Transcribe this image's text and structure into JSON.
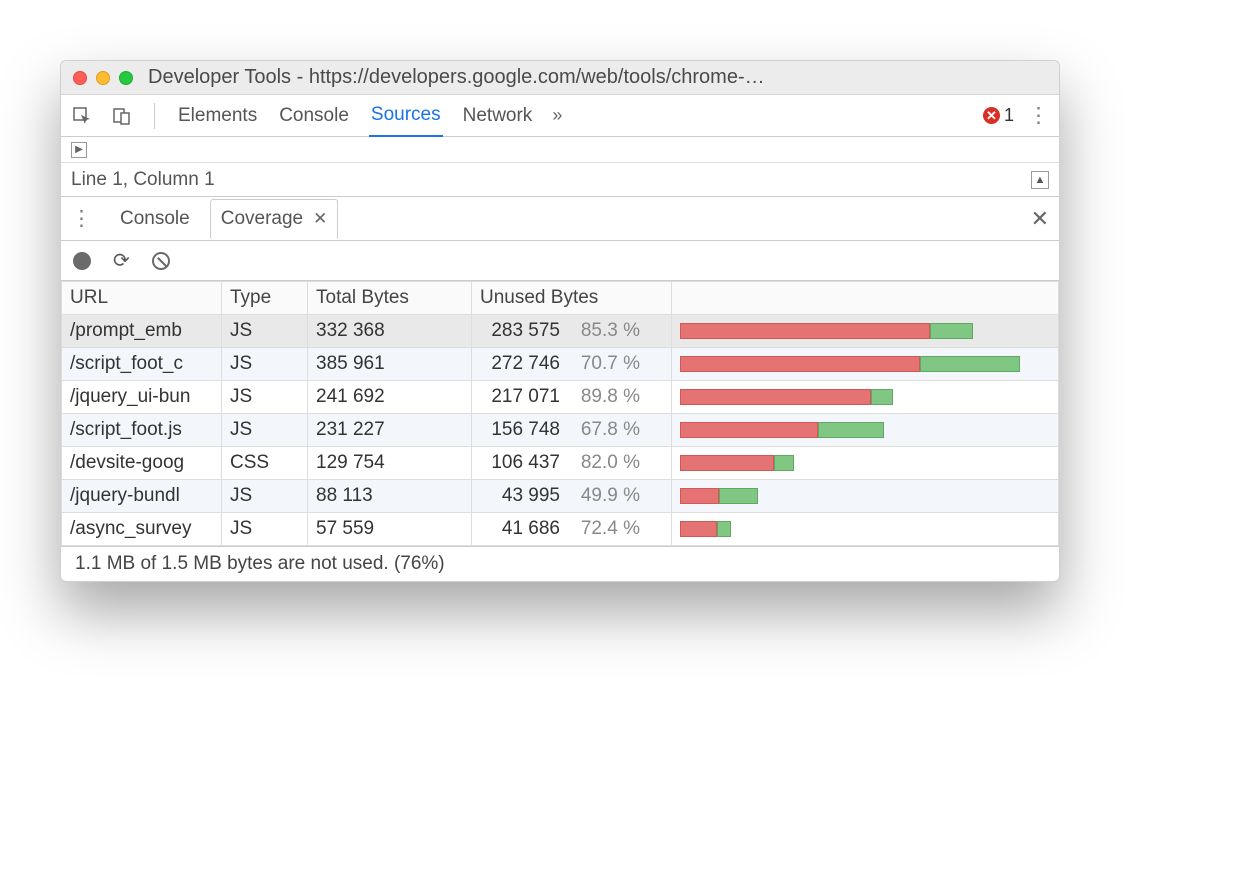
{
  "window": {
    "title": "Developer Tools - https://developers.google.com/web/tools/chrome-…"
  },
  "main_tabs": {
    "items": [
      "Elements",
      "Console",
      "Sources",
      "Network"
    ],
    "active": "Sources",
    "overflow_glyph": "»",
    "error_count": "1"
  },
  "status": {
    "line_col": "Line 1, Column 1"
  },
  "drawer": {
    "tabs": {
      "inactive": "Console",
      "active": "Coverage"
    }
  },
  "coverage": {
    "headers": {
      "url": "URL",
      "type": "Type",
      "total": "Total Bytes",
      "unused": "Unused Bytes"
    },
    "max_total": 385961,
    "rows": [
      {
        "url": "/prompt_emb",
        "type": "JS",
        "total": "332 368",
        "unused": "283 575",
        "pct": "85.3 %",
        "total_n": 332368,
        "unused_n": 283575,
        "selected": true
      },
      {
        "url": "/script_foot_c",
        "type": "JS",
        "total": "385 961",
        "unused": "272 746",
        "pct": "70.7 %",
        "total_n": 385961,
        "unused_n": 272746
      },
      {
        "url": "/jquery_ui-bun",
        "type": "JS",
        "total": "241 692",
        "unused": "217 071",
        "pct": "89.8 %",
        "total_n": 241692,
        "unused_n": 217071
      },
      {
        "url": "/script_foot.js",
        "type": "JS",
        "total": "231 227",
        "unused": "156 748",
        "pct": "67.8 %",
        "total_n": 231227,
        "unused_n": 156748
      },
      {
        "url": "/devsite-goog",
        "type": "CSS",
        "total": "129 754",
        "unused": "106 437",
        "pct": "82.0 %",
        "total_n": 129754,
        "unused_n": 106437
      },
      {
        "url": "/jquery-bundl",
        "type": "JS",
        "total": "88 113",
        "unused": "43 995",
        "pct": "49.9 %",
        "total_n": 88113,
        "unused_n": 43995
      },
      {
        "url": "/async_survey",
        "type": "JS",
        "total": "57 559",
        "unused": "41 686",
        "pct": "72.4 %",
        "total_n": 57559,
        "unused_n": 41686
      }
    ],
    "footer": "1.1 MB of 1.5 MB bytes are not used. (76%)"
  }
}
